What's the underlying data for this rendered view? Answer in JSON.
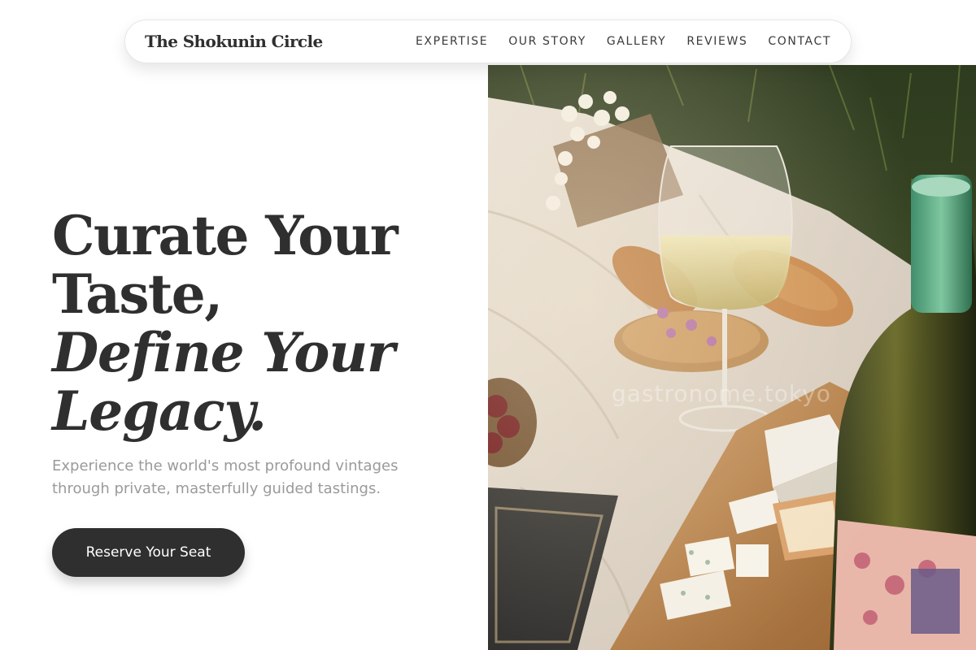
{
  "nav": {
    "brand": "The Shokunin Circle",
    "links": [
      "EXPERTISE",
      "OUR STORY",
      "GALLERY",
      "REVIEWS",
      "CONTACT"
    ]
  },
  "hero": {
    "title_line1": "Curate Your",
    "title_line2": "Taste,",
    "title_line3": "Define Your",
    "title_line4": "Legacy.",
    "subtitle": "Experience the world's most profound vintages through private, masterfully guided tastings.",
    "cta_label": "Reserve Your Seat"
  },
  "image": {
    "watermark": "gastronome.tokyo"
  },
  "colors": {
    "text_dark": "#2f2f2f",
    "text_muted": "#9a9a9a",
    "button_bg": "#2f2f2f",
    "background": "#ffffff"
  }
}
